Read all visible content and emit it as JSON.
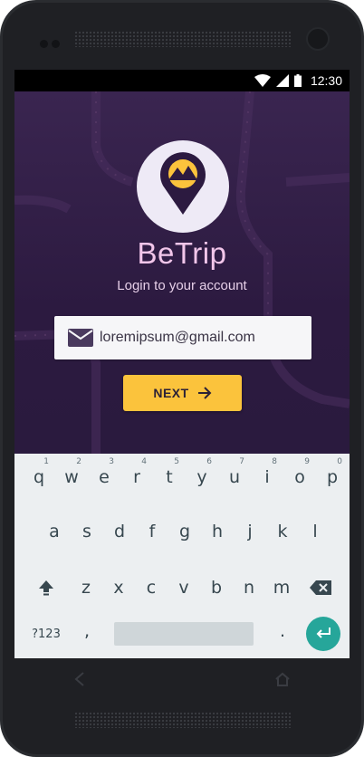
{
  "status_bar": {
    "time": "12:30",
    "icons": [
      "wifi-icon",
      "signal-icon",
      "battery-icon"
    ]
  },
  "app": {
    "name": "BeTrip",
    "subtitle": "Login to your account",
    "email_value": "loremipsum@gmail.com",
    "next_label": "NEXT",
    "logo_icon": "map-pin-sunrise-icon"
  },
  "keyboard": {
    "row1": [
      {
        "key": "q",
        "hint": "1"
      },
      {
        "key": "w",
        "hint": "2"
      },
      {
        "key": "e",
        "hint": "3"
      },
      {
        "key": "r",
        "hint": "4"
      },
      {
        "key": "t",
        "hint": "5"
      },
      {
        "key": "y",
        "hint": "6"
      },
      {
        "key": "u",
        "hint": "7"
      },
      {
        "key": "i",
        "hint": "8"
      },
      {
        "key": "o",
        "hint": "9"
      },
      {
        "key": "p",
        "hint": "0"
      }
    ],
    "row2": [
      "a",
      "s",
      "d",
      "f",
      "g",
      "h",
      "j",
      "k",
      "l"
    ],
    "row3": [
      "z",
      "x",
      "c",
      "v",
      "b",
      "n",
      "m"
    ],
    "symbols_label": "?123",
    "comma": ",",
    "period": "."
  },
  "colors": {
    "background": "#301c44",
    "accent": "#fbc33c",
    "title": "#f2c6ea",
    "enter_key": "#26a69a"
  }
}
